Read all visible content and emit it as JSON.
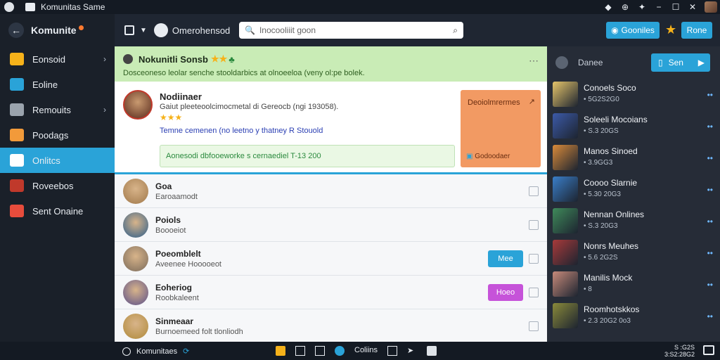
{
  "window": {
    "title": "Komunitas Same"
  },
  "sidebar": {
    "title": "Komunite",
    "items": [
      {
        "label": "Eonsoid",
        "color": "#f6b21a",
        "chevron": true
      },
      {
        "label": "Eoline",
        "color": "#2aa3d8",
        "chevron": false
      },
      {
        "label": "Remouits",
        "color": "#9aa3ad",
        "chevron": true
      },
      {
        "label": "Poodags",
        "color": "#f29a3a",
        "chevron": false
      },
      {
        "label": "Onlitcs",
        "color": "#ffffff",
        "chevron": false,
        "active": true
      },
      {
        "label": "Roveebos",
        "color": "#c0392b",
        "chevron": false
      },
      {
        "label": "Sent Onaine",
        "color": "#e74c3c",
        "chevron": false
      }
    ]
  },
  "topbar": {
    "crumb": "Omerohensod",
    "search_value": "Inocooliiit goon",
    "btn_primary": "Gooniles",
    "btn_secondary": "Rone"
  },
  "banner": {
    "title": "Nokunitli Sonsb",
    "stars": "★★",
    "subtitle": "Dosceoneso leolar senche stooldarbics at olnoeeloa (veny ol:pe bolek."
  },
  "card": {
    "name": "Nodiinaer",
    "desc": "Gaiut pleeteoolcimocmetal di Gereocb (ngi 193058).",
    "stars": "★★★",
    "note": "Temne cemenen (no leetno y thatney R Stouold",
    "green_text": "Aonesodi dbfooeworke s cernaediel T-13 200",
    "orange_title": "Deoiolmrermes",
    "orange_bottom": "Godoodaer"
  },
  "rows": [
    {
      "name": "Goa",
      "sub": "Earoaamodt",
      "color": "#a0784a",
      "button": null
    },
    {
      "name": "Poiols",
      "sub": "Boooeiot",
      "color": "#2b5d8a",
      "button": null
    },
    {
      "name": "Poeomblelt",
      "sub": "Aveenee Hooooeot",
      "color": "#7a6a5a",
      "button": {
        "label": "Mee",
        "color": "#2aa3d8"
      }
    },
    {
      "name": "Eoheriog",
      "sub": "Roobkaleent",
      "color": "#5a4f8a",
      "button": {
        "label": "Hoeo",
        "color": "#c653d9"
      }
    },
    {
      "name": "Sinmeaar",
      "sub": "Burnoemeed folt tlonliodh",
      "color": "#b08a3a",
      "button": null
    }
  ],
  "right": {
    "label": "Danee",
    "search_btn": "Sen",
    "games": [
      {
        "name": "Conoels Soco",
        "sub": "• 5G2S2G0",
        "color": "#e6c56a"
      },
      {
        "name": "Soleeli Mocoians",
        "sub": "• S.3 20GS",
        "color": "#3c5aa8"
      },
      {
        "name": "Manos Sinoed",
        "sub": "• 3.9GG3",
        "color": "#d98a3a"
      },
      {
        "name": "Coooo Slarnie",
        "sub": "• 5.30 20G3",
        "color": "#3a7ec9"
      },
      {
        "name": "Nennan Onlines",
        "sub": "• S.3 20G3",
        "color": "#3f8a5a"
      },
      {
        "name": "Nonrs Meuhes",
        "sub": "• 5.6 2G2S",
        "color": "#a83a3a"
      },
      {
        "name": "Manilis Mock",
        "sub": "• 8",
        "color": "#c78a7a"
      },
      {
        "name": "Roomhotskkos",
        "sub": "• 2.3 20G2 0o3",
        "color": "#8a8a3a"
      }
    ]
  },
  "bottom": {
    "left": "Komunitaes",
    "center_label": "Coliins",
    "time": "S :G2S",
    "date": "3:S2:28G2"
  }
}
